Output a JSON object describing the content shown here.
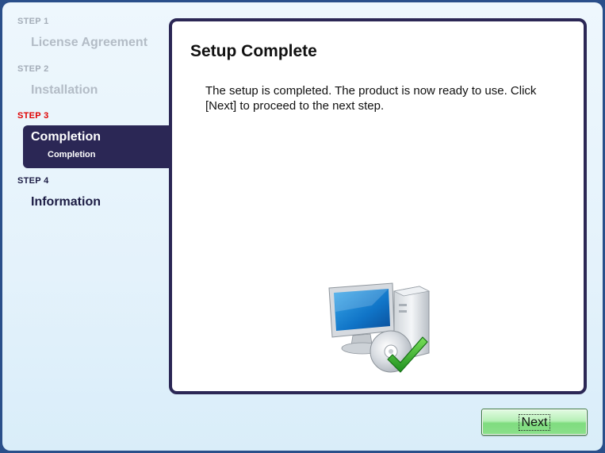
{
  "sidebar": {
    "steps": [
      {
        "step_label": "STEP 1",
        "title": "License Agreement"
      },
      {
        "step_label": "STEP 2",
        "title": "Installation"
      },
      {
        "step_label": "STEP 3",
        "title": "Completion",
        "substep": "Completion"
      },
      {
        "step_label": "STEP 4",
        "title": "Information"
      }
    ]
  },
  "main": {
    "title": "Setup Complete",
    "description": "The setup is completed. The product is now ready to use. Click [Next] to proceed to the next step.",
    "illustration": "computer-cd-checkmark-icon"
  },
  "footer": {
    "next_label": "Next"
  },
  "colors": {
    "active_step": "#e00000",
    "navy": "#2b2755",
    "button_green": "#7fdc7f"
  }
}
